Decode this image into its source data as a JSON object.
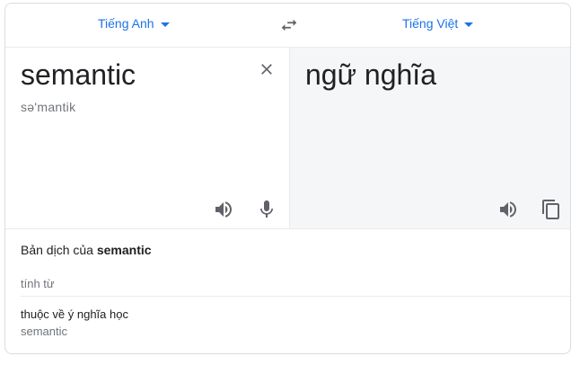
{
  "languages": {
    "source": "Tiếng Anh",
    "target": "Tiếng Việt"
  },
  "source": {
    "text": "semantic",
    "phonetic": "sə'mantik"
  },
  "target": {
    "text": "ngữ nghĩa"
  },
  "dictionary": {
    "title_prefix": "Bản dịch của ",
    "title_word": "semantic",
    "part_of_speech": "tính từ",
    "entries": [
      {
        "meaning": "thuộc về ý nghĩa học",
        "source_word": "semantic"
      }
    ]
  },
  "icons": {
    "swap": "swap-icon",
    "clear": "close-icon",
    "listen": "speaker-icon",
    "microphone": "microphone-icon",
    "copy": "copy-icon",
    "dropdown": "caret-down-icon"
  },
  "colors": {
    "accent": "#1a73e8",
    "icon": "#5f6368",
    "target_pane_bg": "#f5f6f7",
    "muted_text": "#70757a"
  }
}
